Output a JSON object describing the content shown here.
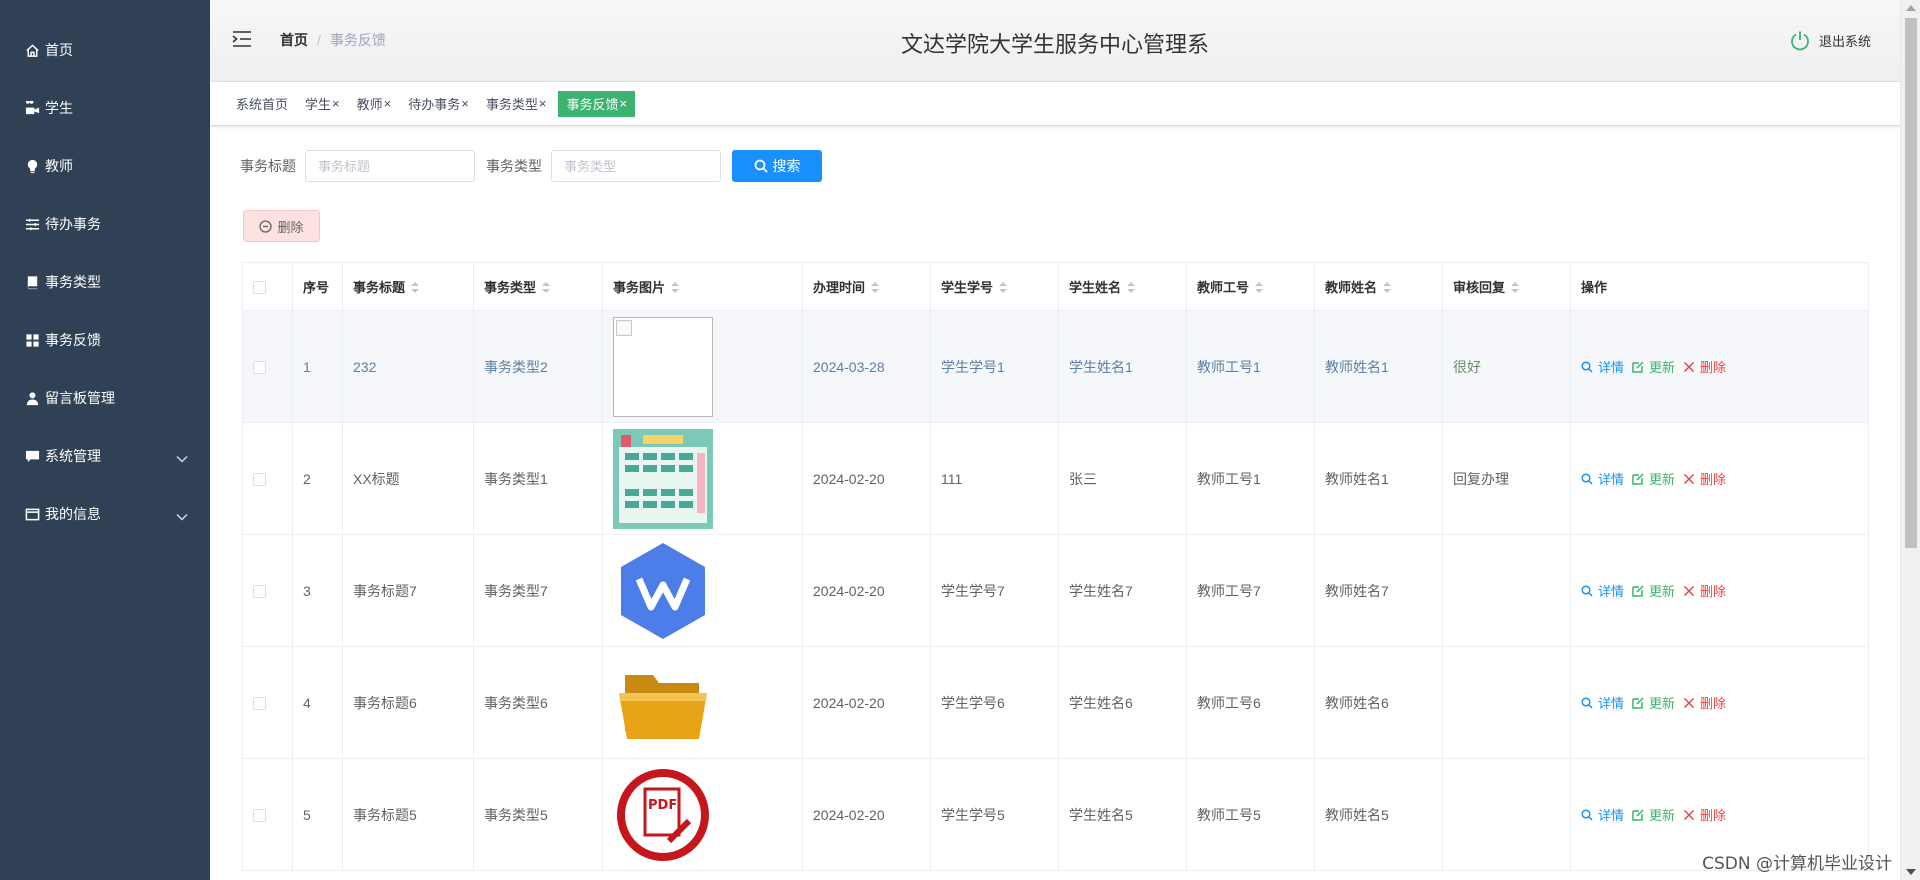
{
  "sidebar": {
    "items": [
      {
        "label": "首页",
        "icon": "home-icon",
        "expandable": false
      },
      {
        "label": "学生",
        "icon": "student-icon",
        "expandable": false
      },
      {
        "label": "教师",
        "icon": "teacher-icon",
        "expandable": false
      },
      {
        "label": "待办事务",
        "icon": "sliders-icon",
        "expandable": false
      },
      {
        "label": "事务类型",
        "icon": "book-icon",
        "expandable": false
      },
      {
        "label": "事务反馈",
        "icon": "grid-icon",
        "expandable": false
      },
      {
        "label": "留言板管理",
        "icon": "user-icon",
        "expandable": false
      },
      {
        "label": "系统管理",
        "icon": "chat-icon",
        "expandable": true
      },
      {
        "label": "我的信息",
        "icon": "window-icon",
        "expandable": true
      }
    ]
  },
  "header": {
    "breadcrumb_home": "首页",
    "breadcrumb_separator": "/",
    "breadcrumb_current": "事务反馈",
    "title": "文达学院大学生服务中心管理系",
    "logout_label": "退出系统"
  },
  "tags": [
    {
      "label": "系统首页",
      "closable": false,
      "active": false
    },
    {
      "label": "学生",
      "closable": true,
      "active": false
    },
    {
      "label": "教师",
      "closable": true,
      "active": false
    },
    {
      "label": "待办事务",
      "closable": true,
      "active": false
    },
    {
      "label": "事务类型",
      "closable": true,
      "active": false
    },
    {
      "label": "事务反馈",
      "closable": true,
      "active": true
    }
  ],
  "tag_close_glyph": "×",
  "search": {
    "title_label": "事务标题",
    "title_placeholder": "事务标题",
    "type_label": "事务类型",
    "type_placeholder": "事务类型",
    "button_label": "搜索"
  },
  "delete_button_label": "删除",
  "table": {
    "columns": [
      "序号",
      "事务标题",
      "事务类型",
      "事务图片",
      "办理时间",
      "学生学号",
      "学生姓名",
      "教师工号",
      "教师姓名",
      "审核回复",
      "操作"
    ],
    "rows": [
      {
        "index": "1",
        "title": "232",
        "type": "事务类型2",
        "image": "broken-image",
        "time": "2024-03-28",
        "student_no": "学生学号1",
        "student_name": "学生姓名1",
        "teacher_no": "教师工号1",
        "teacher_name": "教师姓名1",
        "reply": "很好"
      },
      {
        "index": "2",
        "title": "XX标题",
        "type": "事务类型1",
        "image": "timetable-image",
        "time": "2024-02-20",
        "student_no": "111",
        "student_name": "张三",
        "teacher_no": "教师工号1",
        "teacher_name": "教师姓名1",
        "reply": "回复办理"
      },
      {
        "index": "3",
        "title": "事务标题7",
        "type": "事务类型7",
        "image": "wps-logo-image",
        "time": "2024-02-20",
        "student_no": "学生学号7",
        "student_name": "学生姓名7",
        "teacher_no": "教师工号7",
        "teacher_name": "教师姓名7",
        "reply": ""
      },
      {
        "index": "4",
        "title": "事务标题6",
        "type": "事务类型6",
        "image": "folder-image",
        "time": "2024-02-20",
        "student_no": "学生学号6",
        "student_name": "学生姓名6",
        "teacher_no": "教师工号6",
        "teacher_name": "教师姓名6",
        "reply": ""
      },
      {
        "index": "5",
        "title": "事务标题5",
        "type": "事务类型5",
        "image": "pdf-icon-image",
        "time": "2024-02-20",
        "student_no": "学生学号5",
        "student_name": "学生姓名5",
        "teacher_no": "教师工号5",
        "teacher_name": "教师姓名5",
        "reply": ""
      }
    ],
    "actions": {
      "detail": "详情",
      "update": "更新",
      "delete": "删除"
    }
  },
  "watermark": "CSDN @计算机毕业设计",
  "colors": {
    "sidebar_bg": "#304156",
    "accent_green": "#3cb371",
    "primary_blue": "#1890ff",
    "danger_red": "#e64545"
  }
}
